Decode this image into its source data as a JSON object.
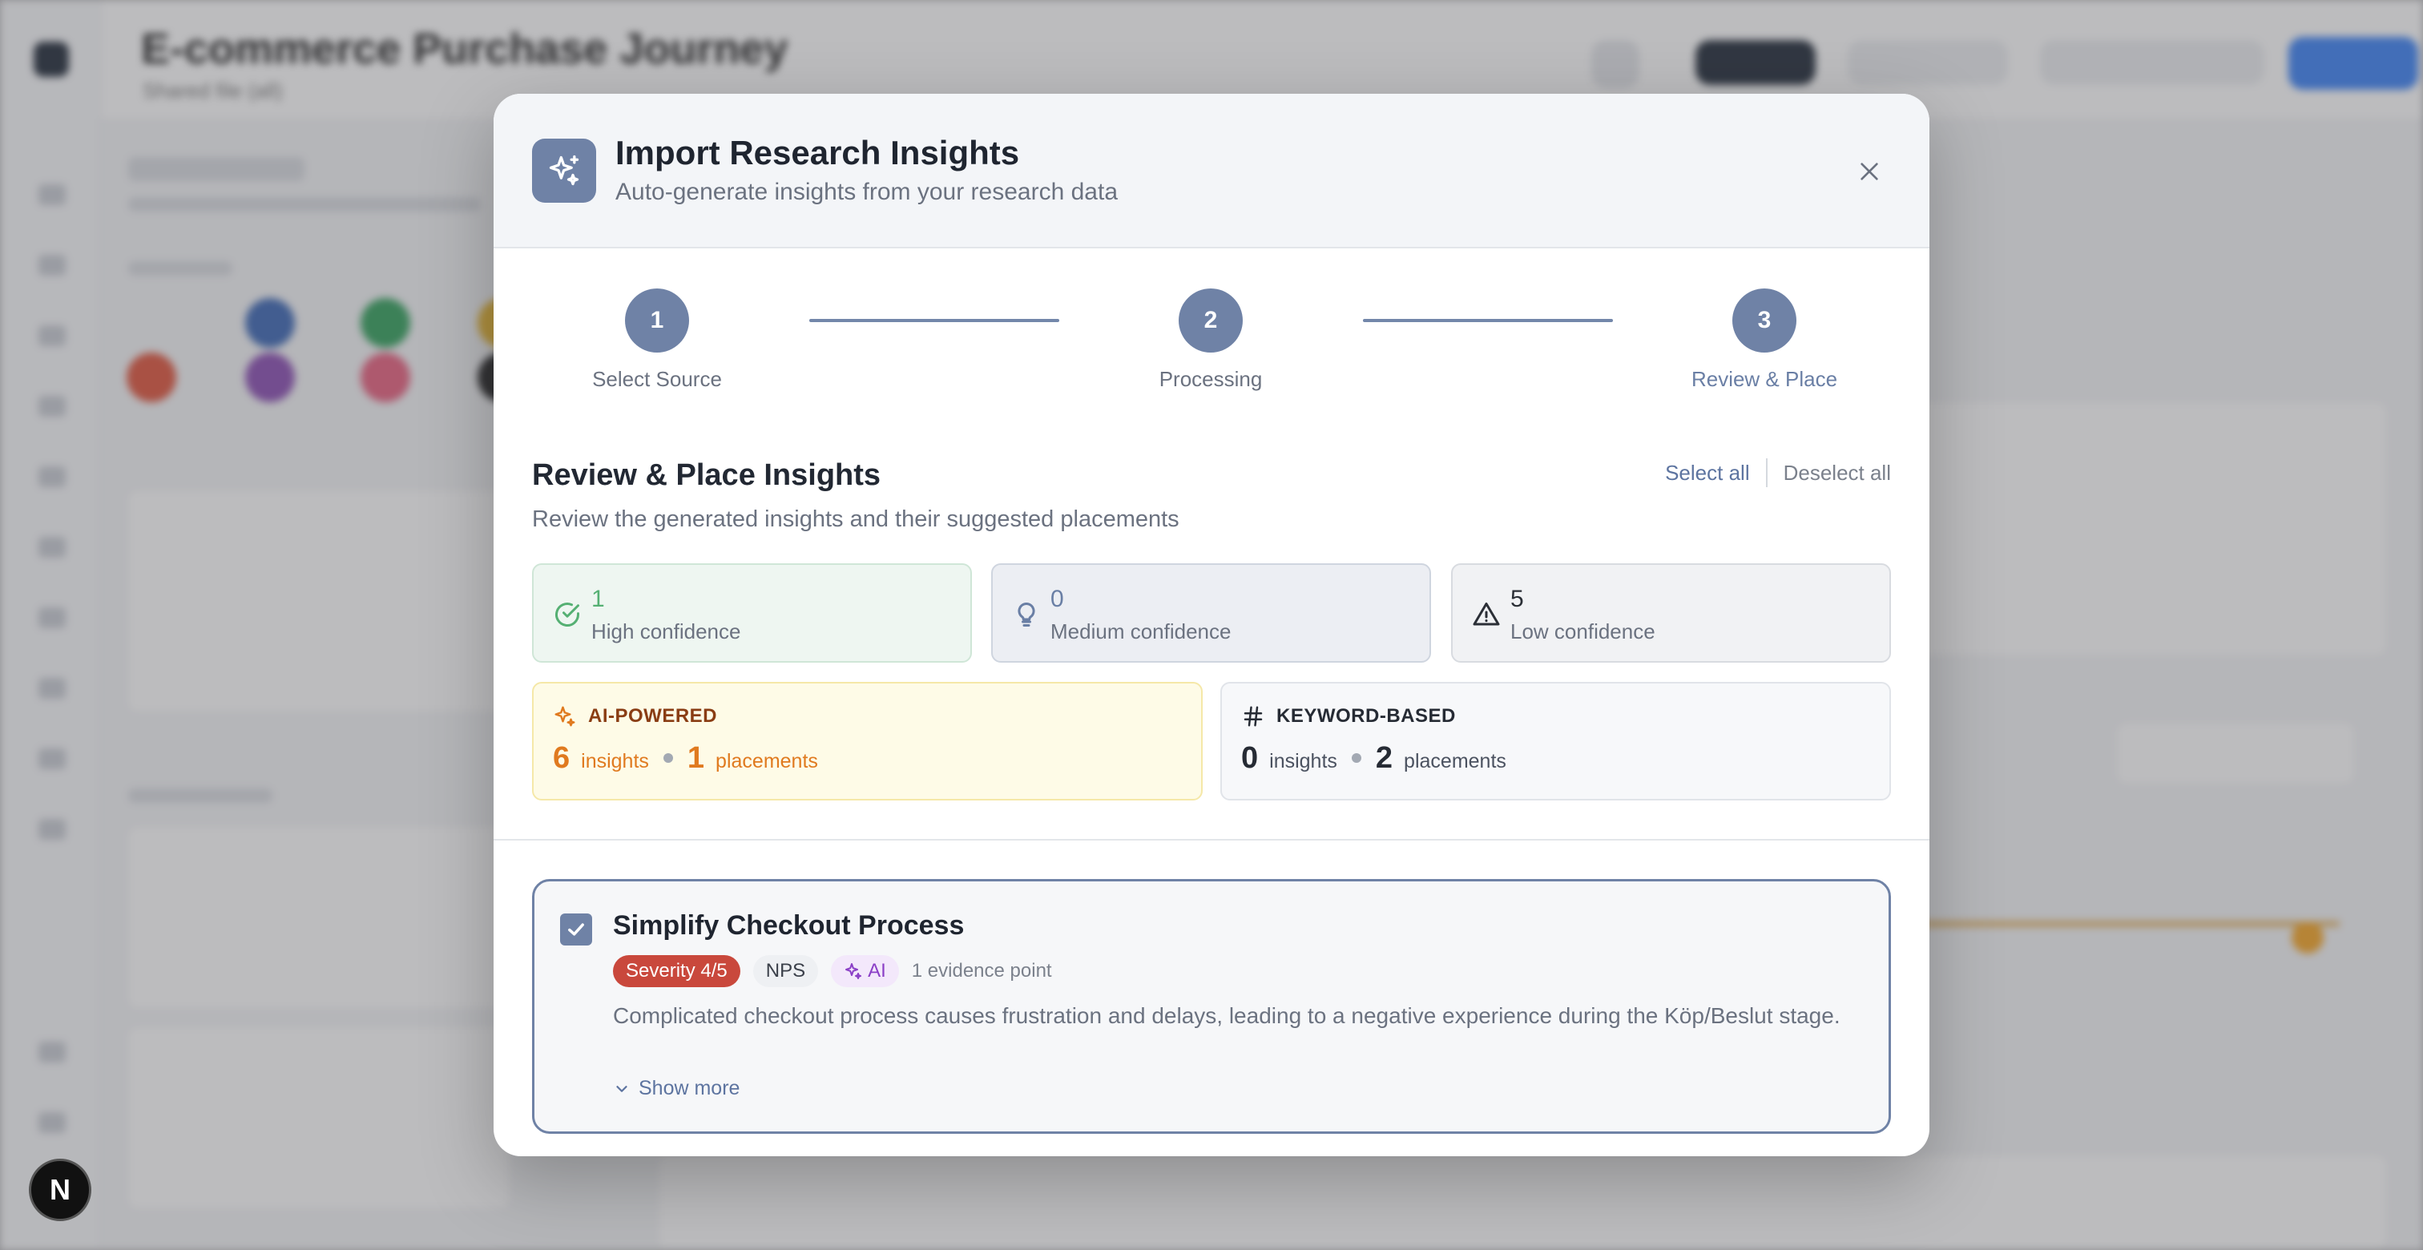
{
  "modal": {
    "title": "Import Research Insights",
    "subtitle": "Auto-generate insights from your research data",
    "close_label": "×"
  },
  "stepper": [
    {
      "number": "1",
      "label": "Select Source"
    },
    {
      "number": "2",
      "label": "Processing"
    },
    {
      "number": "3",
      "label": "Review & Place"
    }
  ],
  "review": {
    "title": "Review & Place Insights",
    "description": "Review the generated insights and their suggested placements",
    "select_all": "Select all",
    "deselect_all": "Deselect all"
  },
  "confidence": {
    "high": {
      "count": "1",
      "label": "High confidence",
      "icon": "check-circle-icon"
    },
    "medium": {
      "count": "0",
      "label": "Medium confidence",
      "icon": "lightbulb-icon"
    },
    "low": {
      "count": "5",
      "label": "Low confidence",
      "icon": "warning-triangle-icon"
    }
  },
  "methods": {
    "ai": {
      "label": "AI-POWERED",
      "insights_count": "6",
      "insights_label": "insights",
      "placements_count": "1",
      "placements_label": "placements",
      "icon": "sparkles-icon"
    },
    "keyword": {
      "label": "KEYWORD-BASED",
      "insights_count": "0",
      "insights_label": "insights",
      "placements_count": "2",
      "placements_label": "placements",
      "icon": "hash-icon"
    }
  },
  "insight": {
    "title": "Simplify Checkout Process",
    "severity": "Severity 4/5",
    "source_tag": "NPS",
    "ai_tag": "AI",
    "evidence": "1 evidence point",
    "description": "Complicated checkout process causes frustration and delays, leading to a negative experience during the Köp/Beslut stage.",
    "show_more": "Show more",
    "checked": true
  },
  "background": {
    "title": "E-commerce Purchase Journey",
    "subtitle": "Shared file (all)"
  },
  "floating_badge": "N",
  "colors": {
    "accent": "#6f82a6",
    "high": "#55b073",
    "ai": "#e07a1f",
    "severity": "#c9483c"
  }
}
